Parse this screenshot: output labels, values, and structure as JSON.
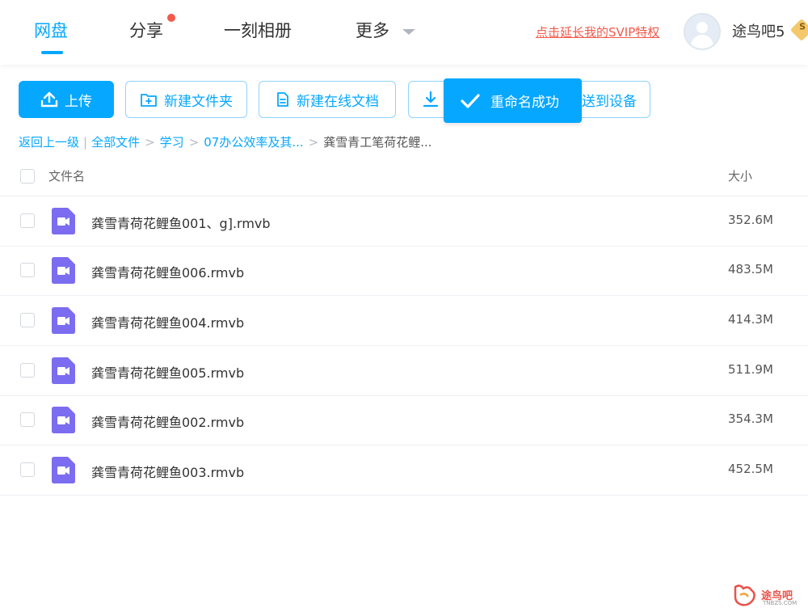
{
  "nav": {
    "items": [
      {
        "label": "网盘"
      },
      {
        "label": "分享"
      },
      {
        "label": "一刻相册"
      },
      {
        "label": "更多"
      }
    ],
    "svip_link": "点击延长我的SVIP特权",
    "username": "途鸟吧5",
    "badge": "S"
  },
  "toolbar": {
    "upload": "上传",
    "new_folder": "新建文件夹",
    "new_doc": "新建在线文档",
    "send_device": "送到设备"
  },
  "toast": {
    "message": "重命名成功"
  },
  "breadcrumb": {
    "back": "返回上一级",
    "items": [
      "全部文件",
      "学习",
      "07办公效率及其...",
      "龚雪青工笔荷花鲤..."
    ]
  },
  "table": {
    "headers": {
      "name": "文件名",
      "size": "大小"
    },
    "rows": [
      {
        "name": "龚雪青荷花鲤鱼001、g].rmvb",
        "size": "352.6M"
      },
      {
        "name": "龚雪青荷花鲤鱼006.rmvb",
        "size": "483.5M"
      },
      {
        "name": "龚雪青荷花鲤鱼004.rmvb",
        "size": "414.3M"
      },
      {
        "name": "龚雪青荷花鲤鱼005.rmvb",
        "size": "511.9M"
      },
      {
        "name": "龚雪青荷花鲤鱼002.rmvb",
        "size": "354.3M"
      },
      {
        "name": "龚雪青荷花鲤鱼003.rmvb",
        "size": "452.5M"
      }
    ]
  },
  "watermark": {
    "text": "途鸟吧",
    "sub": "TNBZS.COM"
  },
  "colors": {
    "accent": "#06a7ff",
    "link_red": "#f25a4b",
    "video_icon": "#7b6cf0"
  }
}
